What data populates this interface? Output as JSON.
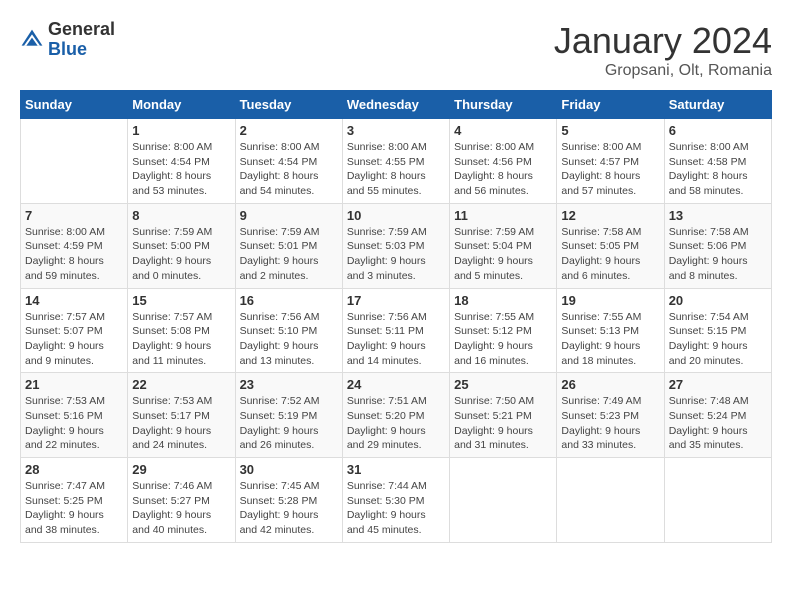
{
  "header": {
    "logo_general": "General",
    "logo_blue": "Blue",
    "month_title": "January 2024",
    "location": "Gropsani, Olt, Romania"
  },
  "weekdays": [
    "Sunday",
    "Monday",
    "Tuesday",
    "Wednesday",
    "Thursday",
    "Friday",
    "Saturday"
  ],
  "weeks": [
    [
      {
        "day": "",
        "sunrise": "",
        "sunset": "",
        "daylight": ""
      },
      {
        "day": "1",
        "sunrise": "Sunrise: 8:00 AM",
        "sunset": "Sunset: 4:54 PM",
        "daylight": "Daylight: 8 hours and 53 minutes."
      },
      {
        "day": "2",
        "sunrise": "Sunrise: 8:00 AM",
        "sunset": "Sunset: 4:54 PM",
        "daylight": "Daylight: 8 hours and 54 minutes."
      },
      {
        "day": "3",
        "sunrise": "Sunrise: 8:00 AM",
        "sunset": "Sunset: 4:55 PM",
        "daylight": "Daylight: 8 hours and 55 minutes."
      },
      {
        "day": "4",
        "sunrise": "Sunrise: 8:00 AM",
        "sunset": "Sunset: 4:56 PM",
        "daylight": "Daylight: 8 hours and 56 minutes."
      },
      {
        "day": "5",
        "sunrise": "Sunrise: 8:00 AM",
        "sunset": "Sunset: 4:57 PM",
        "daylight": "Daylight: 8 hours and 57 minutes."
      },
      {
        "day": "6",
        "sunrise": "Sunrise: 8:00 AM",
        "sunset": "Sunset: 4:58 PM",
        "daylight": "Daylight: 8 hours and 58 minutes."
      }
    ],
    [
      {
        "day": "7",
        "sunrise": "Sunrise: 8:00 AM",
        "sunset": "Sunset: 4:59 PM",
        "daylight": "Daylight: 8 hours and 59 minutes."
      },
      {
        "day": "8",
        "sunrise": "Sunrise: 7:59 AM",
        "sunset": "Sunset: 5:00 PM",
        "daylight": "Daylight: 9 hours and 0 minutes."
      },
      {
        "day": "9",
        "sunrise": "Sunrise: 7:59 AM",
        "sunset": "Sunset: 5:01 PM",
        "daylight": "Daylight: 9 hours and 2 minutes."
      },
      {
        "day": "10",
        "sunrise": "Sunrise: 7:59 AM",
        "sunset": "Sunset: 5:03 PM",
        "daylight": "Daylight: 9 hours and 3 minutes."
      },
      {
        "day": "11",
        "sunrise": "Sunrise: 7:59 AM",
        "sunset": "Sunset: 5:04 PM",
        "daylight": "Daylight: 9 hours and 5 minutes."
      },
      {
        "day": "12",
        "sunrise": "Sunrise: 7:58 AM",
        "sunset": "Sunset: 5:05 PM",
        "daylight": "Daylight: 9 hours and 6 minutes."
      },
      {
        "day": "13",
        "sunrise": "Sunrise: 7:58 AM",
        "sunset": "Sunset: 5:06 PM",
        "daylight": "Daylight: 9 hours and 8 minutes."
      }
    ],
    [
      {
        "day": "14",
        "sunrise": "Sunrise: 7:57 AM",
        "sunset": "Sunset: 5:07 PM",
        "daylight": "Daylight: 9 hours and 9 minutes."
      },
      {
        "day": "15",
        "sunrise": "Sunrise: 7:57 AM",
        "sunset": "Sunset: 5:08 PM",
        "daylight": "Daylight: 9 hours and 11 minutes."
      },
      {
        "day": "16",
        "sunrise": "Sunrise: 7:56 AM",
        "sunset": "Sunset: 5:10 PM",
        "daylight": "Daylight: 9 hours and 13 minutes."
      },
      {
        "day": "17",
        "sunrise": "Sunrise: 7:56 AM",
        "sunset": "Sunset: 5:11 PM",
        "daylight": "Daylight: 9 hours and 14 minutes."
      },
      {
        "day": "18",
        "sunrise": "Sunrise: 7:55 AM",
        "sunset": "Sunset: 5:12 PM",
        "daylight": "Daylight: 9 hours and 16 minutes."
      },
      {
        "day": "19",
        "sunrise": "Sunrise: 7:55 AM",
        "sunset": "Sunset: 5:13 PM",
        "daylight": "Daylight: 9 hours and 18 minutes."
      },
      {
        "day": "20",
        "sunrise": "Sunrise: 7:54 AM",
        "sunset": "Sunset: 5:15 PM",
        "daylight": "Daylight: 9 hours and 20 minutes."
      }
    ],
    [
      {
        "day": "21",
        "sunrise": "Sunrise: 7:53 AM",
        "sunset": "Sunset: 5:16 PM",
        "daylight": "Daylight: 9 hours and 22 minutes."
      },
      {
        "day": "22",
        "sunrise": "Sunrise: 7:53 AM",
        "sunset": "Sunset: 5:17 PM",
        "daylight": "Daylight: 9 hours and 24 minutes."
      },
      {
        "day": "23",
        "sunrise": "Sunrise: 7:52 AM",
        "sunset": "Sunset: 5:19 PM",
        "daylight": "Daylight: 9 hours and 26 minutes."
      },
      {
        "day": "24",
        "sunrise": "Sunrise: 7:51 AM",
        "sunset": "Sunset: 5:20 PM",
        "daylight": "Daylight: 9 hours and 29 minutes."
      },
      {
        "day": "25",
        "sunrise": "Sunrise: 7:50 AM",
        "sunset": "Sunset: 5:21 PM",
        "daylight": "Daylight: 9 hours and 31 minutes."
      },
      {
        "day": "26",
        "sunrise": "Sunrise: 7:49 AM",
        "sunset": "Sunset: 5:23 PM",
        "daylight": "Daylight: 9 hours and 33 minutes."
      },
      {
        "day": "27",
        "sunrise": "Sunrise: 7:48 AM",
        "sunset": "Sunset: 5:24 PM",
        "daylight": "Daylight: 9 hours and 35 minutes."
      }
    ],
    [
      {
        "day": "28",
        "sunrise": "Sunrise: 7:47 AM",
        "sunset": "Sunset: 5:25 PM",
        "daylight": "Daylight: 9 hours and 38 minutes."
      },
      {
        "day": "29",
        "sunrise": "Sunrise: 7:46 AM",
        "sunset": "Sunset: 5:27 PM",
        "daylight": "Daylight: 9 hours and 40 minutes."
      },
      {
        "day": "30",
        "sunrise": "Sunrise: 7:45 AM",
        "sunset": "Sunset: 5:28 PM",
        "daylight": "Daylight: 9 hours and 42 minutes."
      },
      {
        "day": "31",
        "sunrise": "Sunrise: 7:44 AM",
        "sunset": "Sunset: 5:30 PM",
        "daylight": "Daylight: 9 hours and 45 minutes."
      },
      {
        "day": "",
        "sunrise": "",
        "sunset": "",
        "daylight": ""
      },
      {
        "day": "",
        "sunrise": "",
        "sunset": "",
        "daylight": ""
      },
      {
        "day": "",
        "sunrise": "",
        "sunset": "",
        "daylight": ""
      }
    ]
  ]
}
